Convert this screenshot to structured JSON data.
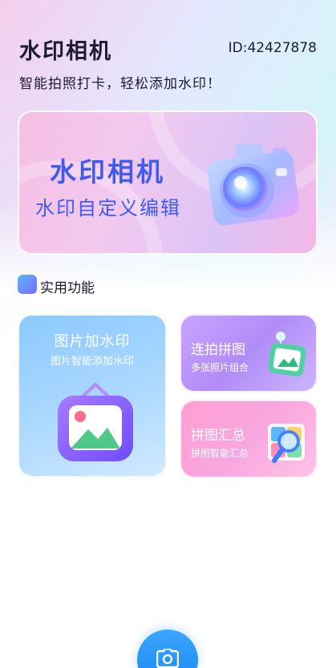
{
  "header": {
    "app_title": "水印相机",
    "user_id": "ID:42427878",
    "subtitle": "智能拍照打卡，轻松添加水印！"
  },
  "banner": {
    "title": "水印相机",
    "subtitle": "水印自定义编辑",
    "icon": "3d-camera-icon"
  },
  "section": {
    "title": "实用功能",
    "icon": "feature-icon"
  },
  "cards": {
    "watermark": {
      "title": "图片加水印",
      "subtitle": "图片智能添加水印",
      "icon": "image-frame-icon"
    },
    "collage": {
      "title": "连拍拼图",
      "subtitle": "多张照片组合",
      "icon": "collage-icon"
    },
    "summary": {
      "title": "拼图汇总",
      "subtitle": "拼图智能汇总",
      "icon": "magnifier-grid-icon"
    }
  },
  "bottom": {
    "icon": "camera-icon"
  },
  "colors": {
    "accent_blue": "#3f5bf0",
    "fab_blue": "#1a86ef",
    "card_blue": "#8cc9ff",
    "card_purple": "#b18cf7",
    "card_pink": "#ff9fd2"
  }
}
